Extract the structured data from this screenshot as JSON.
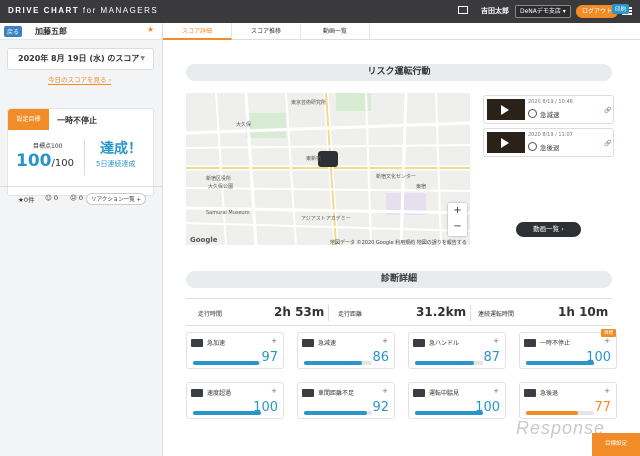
{
  "app": {
    "logo_main": "DRIVE CHART",
    "logo_sub": "for MANAGERS",
    "user": "吉田太郎",
    "store": "DeNAデモ支店 ▾",
    "logout": "ログアウト"
  },
  "sidebar": {
    "back": "戻る",
    "driver": "加藤五郎",
    "date": "2020年 8月 19日 (水) のスコア",
    "today_link": "今日のスコアを見る ›",
    "goal": {
      "tag": "設定目標",
      "title": "一時不停止",
      "target_label": "目標点100",
      "score": "100",
      "score_suffix": "/100",
      "achieved": "達成！",
      "streak": "5日連続達成"
    },
    "reactions": [
      {
        "icon": "star-icon",
        "text": "★0件"
      },
      {
        "icon": "smile-icon",
        "text": "0"
      },
      {
        "icon": "face-icon",
        "text": "0"
      }
    ],
    "reaction_list": "リアクション一覧 +"
  },
  "tabs": [
    "スコア詳細",
    "スコア推移",
    "動画一覧"
  ],
  "print": "印刷",
  "risk": {
    "title": "リスク運転行動",
    "videos": [
      {
        "date": "2020 8/19 / 10:46",
        "type": "急減速"
      },
      {
        "date": "2020 8/19 / 11:07",
        "type": "急後退"
      }
    ],
    "list_button": "動画一覧 ›",
    "map_labels": [
      "東京芸術研究所",
      "大久保",
      "新宿区役所",
      "大久保公園",
      "Samurai Museum",
      "アジアストアカデミー",
      "新宿",
      "東新宿",
      "新宿文化センター",
      "東宿"
    ],
    "map_credit": "地図データ ©2020 Google  利用規約  地図の誤りを報告する",
    "google": "Google"
  },
  "diagnosis": {
    "title": "診断詳細",
    "stats": [
      {
        "label": "走行時間",
        "value": "2h 53m"
      },
      {
        "label": "走行距離",
        "value": "31.2km"
      },
      {
        "label": "連続運転時間",
        "value": "1h 10m"
      }
    ],
    "cards": [
      {
        "label": "急加速",
        "value": 97,
        "icon": "car-accel-icon"
      },
      {
        "label": "急減速",
        "value": 86,
        "icon": "car-brake-icon"
      },
      {
        "label": "急ハンドル",
        "value": 87,
        "icon": "steering-icon"
      },
      {
        "label": "一時不停止",
        "value": 100,
        "icon": "stop-icon",
        "flag": "目標"
      },
      {
        "label": "速度超過",
        "value": 100,
        "icon": "speed-icon"
      },
      {
        "label": "車間距離不足",
        "value": 92,
        "icon": "distance-icon"
      },
      {
        "label": "運転中脇見",
        "value": 100,
        "icon": "eye-icon"
      },
      {
        "label": "急後退",
        "value": 77,
        "icon": "reverse-icon",
        "color": "#f28c28"
      }
    ]
  },
  "footer": {
    "watermark": "Response",
    "corner": "目標設定"
  }
}
